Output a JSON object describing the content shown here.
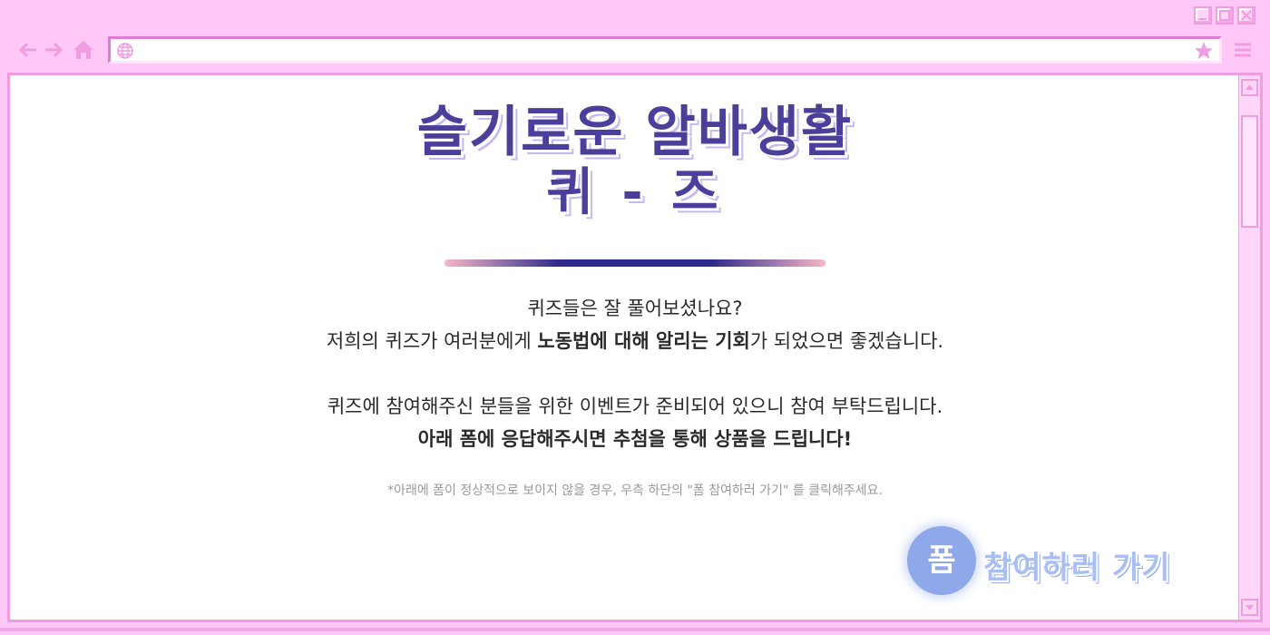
{
  "browser": {
    "url": "",
    "colors": {
      "frame": "#ffc8f7",
      "border": "#f09ce0",
      "icon": "#f09ce0"
    }
  },
  "page": {
    "title_line1": "슬기로운 알바생활",
    "title_line2": "퀴 - 즈",
    "line1": "퀴즈들은 잘 풀어보셨나요?",
    "line2_prefix": "저희의 퀴즈가 여러분에게 ",
    "line2_bold": "노동법에 대해 알리는 기회",
    "line2_suffix": "가 되었으면 좋겠습니다.",
    "line3": "퀴즈에 참여해주신 분들을 위한 이벤트가 준비되어 있으니 참여 부탁드립니다.",
    "line4": "아래 폼에 응답해주시면 추첨을 통해 상품을 드립니다!",
    "note": "*아래에 폼이 정상적으로 보이지 않을 경우, 우측 하단의 \"폼 참여하러 가기\" 를 클릭해주세요.",
    "cta_icon_text": "폼",
    "cta_label": "참여하러 가기",
    "colors": {
      "title": "#4a3f9a",
      "cta": "#8fa8ea"
    }
  }
}
